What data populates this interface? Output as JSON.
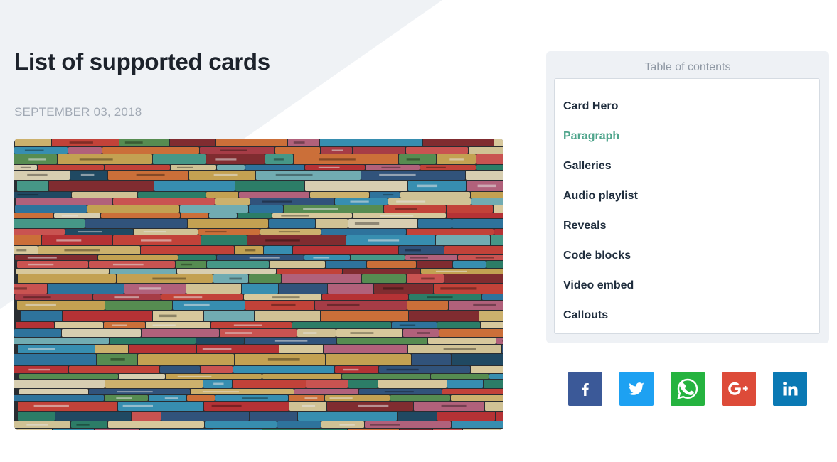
{
  "article": {
    "title": "List of supported cards",
    "date": "SEPTEMBER 03, 2018",
    "hero_alt": "colorful book spines stacked horizontally"
  },
  "toc": {
    "heading": "Table of contents",
    "items": [
      {
        "label": "Card Hero",
        "active": false
      },
      {
        "label": "Paragraph",
        "active": true
      },
      {
        "label": "Galleries",
        "active": false
      },
      {
        "label": "Audio playlist",
        "active": false
      },
      {
        "label": "Reveals",
        "active": false
      },
      {
        "label": "Code blocks",
        "active": false
      },
      {
        "label": "Video embed",
        "active": false
      },
      {
        "label": "Callouts",
        "active": false
      }
    ]
  },
  "share": [
    {
      "name": "facebook",
      "icon": "facebook-icon",
      "color": "#3b5998"
    },
    {
      "name": "twitter",
      "icon": "twitter-icon",
      "color": "#1da1f2"
    },
    {
      "name": "whatsapp",
      "icon": "whatsapp-icon",
      "color": "#25b33f"
    },
    {
      "name": "google-plus",
      "icon": "google-plus-icon",
      "color": "#dd4b39"
    },
    {
      "name": "linkedin",
      "icon": "linkedin-icon",
      "color": "#0a79b4"
    }
  ],
  "colors": {
    "accent": "#4fa58c",
    "background_shape": "#eff2f5"
  }
}
